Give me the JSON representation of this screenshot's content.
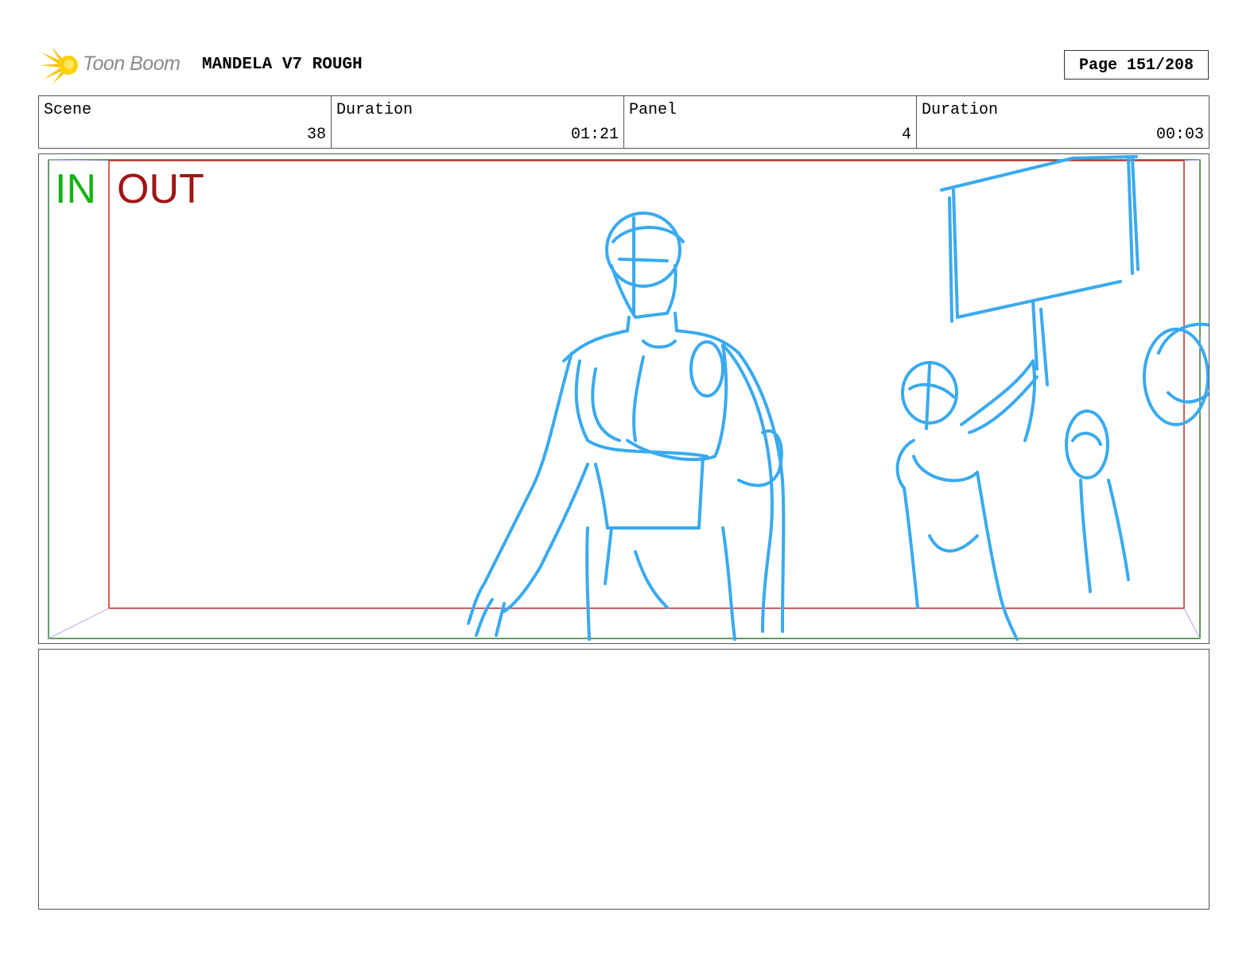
{
  "header": {
    "logo_text": "Toon Boom",
    "logo_icon": "starburst-icon",
    "title": "MANDELA V7 ROUGH",
    "page_label": "Page 151/208"
  },
  "info": [
    {
      "label": "Scene",
      "value": "38"
    },
    {
      "label": "Duration",
      "value": "01:21"
    },
    {
      "label": "Panel",
      "value": "4"
    },
    {
      "label": "Duration",
      "value": "00:03"
    }
  ],
  "panel": {
    "in_label": "IN",
    "out_label": "OUT",
    "sketch_color": "#3aaaf0",
    "in_frame_color": "#2e7d32",
    "out_frame_color": "#c62828"
  },
  "notes": {
    "text": ""
  }
}
